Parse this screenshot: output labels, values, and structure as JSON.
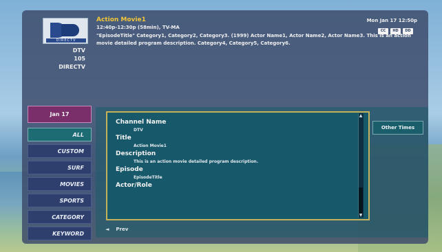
{
  "header": {
    "channel": {
      "number": "DTV",
      "alt_number": "105",
      "network": "DIRECTV"
    },
    "logo": {
      "icon": "directv-logo",
      "text": "DIRECTV"
    },
    "program": {
      "title": "Action Movie1",
      "time_line": "12:40p-12:30p (58min), TV-MA",
      "description": "\"EpisodeTitle\" Category1, Category2, Category3. (1999) Actor Name1, Actor Name2, Actor Name3. This is an action movie detailed program description. Category4, Category5, Category6."
    },
    "clock": "Mon Jan 17 12:50p",
    "badges": [
      "CC",
      "HD",
      "DD"
    ]
  },
  "sidebar": {
    "date": "Jan 17",
    "items": [
      {
        "label": "ALL",
        "selected": true
      },
      {
        "label": "CUSTOM",
        "selected": false
      },
      {
        "label": "SURF",
        "selected": false
      },
      {
        "label": "MOVIES",
        "selected": false
      },
      {
        "label": "SPORTS",
        "selected": false
      },
      {
        "label": "CATEGORY",
        "selected": false
      },
      {
        "label": "KEYWORD",
        "selected": false
      }
    ]
  },
  "details": {
    "fields": [
      {
        "label": "Channel Name",
        "value": "DTV"
      },
      {
        "label": "Title",
        "value": "Action Movie1"
      },
      {
        "label": "Description",
        "value": "This is an action movie detailed program description."
      },
      {
        "label": "Episode",
        "value": "EpisodeTitle"
      },
      {
        "label": "Actor/Role",
        "value": ""
      }
    ]
  },
  "buttons": {
    "other_times": "Other Times",
    "prev": "Prev"
  },
  "colors": {
    "title_accent": "#f3c63a",
    "date_tab": "#7a2f6a",
    "detail_border": "#c6b25b",
    "detail_bg": "#17586a"
  }
}
